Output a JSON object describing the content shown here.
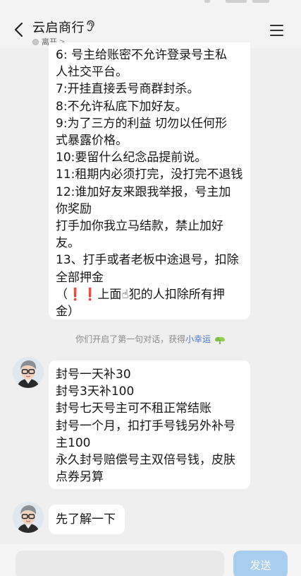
{
  "header": {
    "title": "云启商行",
    "presence_text": "离开",
    "presence_chevron": ">"
  },
  "messages": {
    "first_lines": [
      "6:  号主给账密不允许登录号主私",
      "人社交平台。",
      "7:开挂直接丢号商群封杀。",
      "8:不允许私底下加好友。",
      "9:为了三方的利益 切勿以任何形",
      "式暴露价格。",
      "10:要留什么纪念品提前说。",
      "11:租期内必须打完，没打完不退钱",
      "12:谁加好友来跟我举报，号主加",
      "你奖励",
      "打手加你我立马结款，禁止加好",
      "友。",
      "13、打手或者老板中途退号，扣除",
      "全部押金"
    ],
    "last_line_open": "（",
    "last_line_excl": "❗❗",
    "last_line_rest": "上面☝犯的人扣除所有押",
    "last_line_end": "金）",
    "system_note_prefix": "你们开启了第一句对话，获得",
    "system_note_highlight": "小幸运",
    "second_lines": [
      "封号一天补30",
      "封号3天补100",
      "封号七天号主可不租正常结账",
      "封号一个月，扣打手号钱另外补号",
      "主100",
      "永久封号赔偿号主双倍号钱，皮肤",
      "点券另算"
    ],
    "third_text": "先了解一下"
  },
  "composer": {
    "input_value": "",
    "send_label": "发送"
  },
  "icons": {
    "back": "back-arrow-icon",
    "ear": "ear-icon",
    "menu": "menu-icon",
    "clover": "clover-icon"
  },
  "colors": {
    "background": "#efefef",
    "bubble": "#ffffff",
    "send_button": "#a9cdee",
    "highlight_link": "#4a76c9",
    "warning": "#e0202a"
  }
}
